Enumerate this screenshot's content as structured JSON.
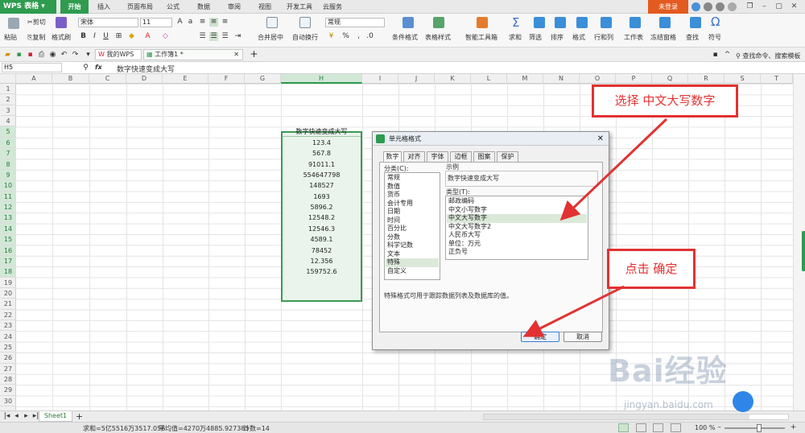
{
  "app": {
    "name": "WPS 表格",
    "login": "未登录",
    "tabs": [
      "开始",
      "插入",
      "页面布局",
      "公式",
      "数据",
      "审阅",
      "视图",
      "开发工具",
      "云服务"
    ]
  },
  "ribbon": {
    "paste": "粘贴",
    "cut": "剪切",
    "copy": "复制",
    "format_painter": "格式刷",
    "font_name": "宋体",
    "font_size": "11",
    "bold": "B",
    "italic": "I",
    "underline": "U",
    "merge_center": "合并居中",
    "wrap_text": "自动换行",
    "number_format": "常规",
    "percent": "%",
    "conditional_format": "条件格式",
    "table_style": "表格样式",
    "smart_toolbox": "智能工具箱",
    "sum": "求和",
    "filter": "筛选",
    "sort": "排序",
    "format": "格式",
    "rows_cols": "行和列",
    "worksheet": "工作表",
    "freeze": "冻结窗格",
    "find": "查找",
    "symbol": "符号"
  },
  "doc_tabs": {
    "my_wps": "我的WPS",
    "workbook": "工作簿1 *",
    "search_hint": "查找命令、搜索模板"
  },
  "formula_bar": {
    "cell_ref": "H5",
    "fx": "fx",
    "content": "数字快速变成大写"
  },
  "columns": [
    "A",
    "B",
    "C",
    "D",
    "E",
    "F",
    "G",
    "H",
    "I",
    "J",
    "K",
    "L",
    "M",
    "N",
    "O",
    "P",
    "Q",
    "R",
    "S",
    "T"
  ],
  "rows": [
    "1",
    "2",
    "3",
    "4",
    "5",
    "6",
    "7",
    "8",
    "9",
    "10",
    "11",
    "12",
    "13",
    "14",
    "15",
    "16",
    "17",
    "18",
    "19",
    "20",
    "21",
    "22",
    "23",
    "24",
    "25",
    "26",
    "27",
    "28",
    "29",
    "30"
  ],
  "column_h": [
    "数字快速变成大写",
    "123.4",
    "567.8",
    "91011.1",
    "554647798",
    "148527",
    "1693",
    "5896.2",
    "12548.2",
    "12546.3",
    "4589.1",
    "78452",
    "12.356",
    "159752.6"
  ],
  "dialog": {
    "title": "单元格格式",
    "tabs": [
      "数字",
      "对齐",
      "字体",
      "边框",
      "图案",
      "保护"
    ],
    "category_label": "分类(C):",
    "categories": [
      "常规",
      "数值",
      "货币",
      "会计专用",
      "日期",
      "时间",
      "百分比",
      "分数",
      "科学记数",
      "文本",
      "特殊",
      "自定义"
    ],
    "selected_category": "特殊",
    "sample_label": "示例",
    "sample_value": "数字快速变成大写",
    "type_label": "类型(T):",
    "types": [
      "邮政编码",
      "中文小写数字",
      "中文大写数字",
      "中文大写数字2",
      "人民币大写",
      "单位：万元",
      "正负号"
    ],
    "selected_type": "中文大写数字",
    "description": "特殊格式可用于跟踪数据列表及数据库的值。",
    "ok": "确定",
    "cancel": "取消"
  },
  "annotations": {
    "select_hint": "选择 中文大写数字",
    "click_hint": "点击 确定"
  },
  "sheet": {
    "tab": "Sheet1"
  },
  "status": {
    "sum": "求和=5亿5516万3517.056",
    "average": "平均值=4270万4885.927385",
    "count": "计数=14",
    "zoom": "100 %"
  },
  "watermark": {
    "brand": "Bai经验",
    "url": "jingyan.baidu.com"
  },
  "colors": {
    "accent": "#2e9b4f",
    "annotation": "#e23232",
    "login": "#e35b1f"
  }
}
